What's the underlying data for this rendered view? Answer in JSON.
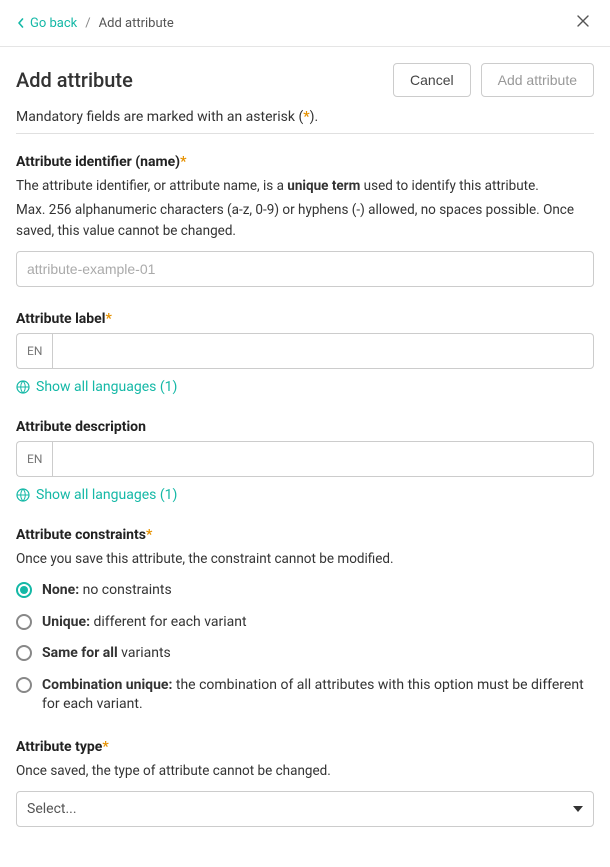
{
  "header": {
    "go_back": "Go back",
    "breadcrumb_current": "Add attribute"
  },
  "page": {
    "title": "Add attribute",
    "mandatory_prefix": "Mandatory fields are marked with an asterisk (",
    "mandatory_suffix": ")."
  },
  "buttons": {
    "cancel": "Cancel",
    "add": "Add attribute"
  },
  "identifier": {
    "label": "Attribute identifier (name)",
    "desc_prefix": "The attribute identifier, or attribute name, is a ",
    "desc_bold": "unique term",
    "desc_suffix": " used to identify this attribute.",
    "desc2": "Max. 256 alphanumeric characters (a-z, 0-9) or hyphens (-) allowed, no spaces possible. Once saved, this value cannot be changed.",
    "placeholder": "attribute-example-01"
  },
  "label_section": {
    "label": "Attribute label",
    "lang": "EN",
    "show_all": "Show all languages (1)"
  },
  "description_section": {
    "label": "Attribute description",
    "lang": "EN",
    "show_all": "Show all languages (1)"
  },
  "constraints": {
    "label": "Attribute constraints",
    "desc": "Once you save this attribute, the constraint cannot be modified.",
    "options": [
      {
        "bold": "None:",
        "rest": " no constraints",
        "checked": true
      },
      {
        "bold": "Unique:",
        "rest": " different for each variant",
        "checked": false
      },
      {
        "bold": "Same for all",
        "rest": " variants",
        "checked": false
      },
      {
        "bold": "Combination unique:",
        "rest": " the combination of all attributes with this option must be different for each variant.",
        "checked": false
      }
    ]
  },
  "type_section": {
    "label": "Attribute type",
    "desc": "Once saved, the type of attribute cannot be changed.",
    "select_placeholder": "Select..."
  }
}
